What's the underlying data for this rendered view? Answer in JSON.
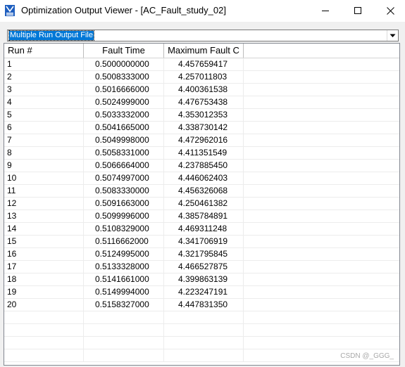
{
  "window": {
    "title": "Optimization Output Viewer - [AC_Fault_study_02]"
  },
  "dropdown": {
    "selected": "Multiple Run Output File"
  },
  "table": {
    "columns": [
      "Run #",
      "Fault Time",
      "Maximum Fault C"
    ],
    "rows": [
      [
        "1",
        "0.5000000000",
        "4.457659417"
      ],
      [
        "2",
        "0.5008333000",
        "4.257011803"
      ],
      [
        "3",
        "0.5016666000",
        "4.400361538"
      ],
      [
        "4",
        "0.5024999000",
        "4.476753438"
      ],
      [
        "5",
        "0.5033332000",
        "4.353012353"
      ],
      [
        "6",
        "0.5041665000",
        "4.338730142"
      ],
      [
        "7",
        "0.5049998000",
        "4.472962016"
      ],
      [
        "8",
        "0.5058331000",
        "4.411351549"
      ],
      [
        "9",
        "0.5066664000",
        "4.237885450"
      ],
      [
        "10",
        "0.5074997000",
        "4.446062403"
      ],
      [
        "11",
        "0.5083330000",
        "4.456326068"
      ],
      [
        "12",
        "0.5091663000",
        "4.250461382"
      ],
      [
        "13",
        "0.5099996000",
        "4.385784891"
      ],
      [
        "14",
        "0.5108329000",
        "4.469311248"
      ],
      [
        "15",
        "0.5116662000",
        "4.341706919"
      ],
      [
        "16",
        "0.5124995000",
        "4.321795845"
      ],
      [
        "17",
        "0.5133328000",
        "4.466527875"
      ],
      [
        "18",
        "0.5141661000",
        "4.399863139"
      ],
      [
        "19",
        "0.5149994000",
        "4.223247191"
      ],
      [
        "20",
        "0.5158327000",
        "4.447831350"
      ]
    ]
  },
  "watermark": "CSDN @_GGG_",
  "colors": {
    "selection": "#0078d7",
    "app_icon": "#1f5fbf"
  }
}
